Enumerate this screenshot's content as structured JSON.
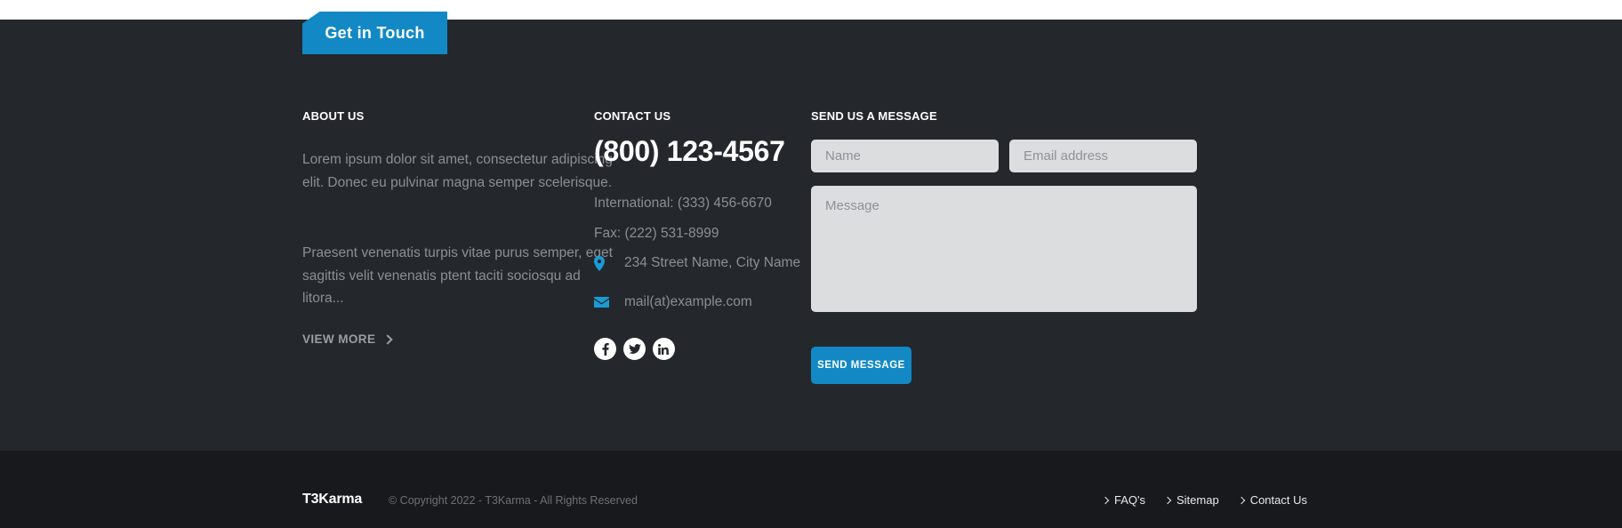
{
  "tab": {
    "label": "Get in Touch"
  },
  "about": {
    "heading": "ABOUT US",
    "paragraph1": "Lorem ipsum dolor sit amet, consectetur adipiscing elit. Donec eu pulvinar magna semper scelerisque.",
    "paragraph2": "Praesent venenatis turpis vitae purus semper, eget sagittis velit venenatis ptent taciti sociosqu ad litora...",
    "view_more_label": "VIEW MORE",
    "view_more_icon": "chevron-right-icon"
  },
  "contact": {
    "heading": "CONTACT US",
    "phone": "(800) 123-4567",
    "international": "International: (333) 456-6670",
    "fax": "Fax: (222) 531-8999",
    "address": "234 Street Name, City Name",
    "address_icon": "map-pin-icon",
    "email": "mail(at)example.com",
    "email_icon": "envelope-icon",
    "social": [
      {
        "name": "facebook-icon",
        "label": "f"
      },
      {
        "name": "twitter-icon",
        "label": "t"
      },
      {
        "name": "linkedin-icon",
        "label": "in"
      }
    ]
  },
  "form": {
    "heading": "SEND US A MESSAGE",
    "name_placeholder": "Name",
    "name_value": "",
    "email_placeholder": "Email address",
    "email_value": "",
    "message_placeholder": "Message",
    "message_value": "",
    "submit_label": "SEND MESSAGE"
  },
  "bottom": {
    "brand": "T3Karma",
    "copyright": "© Copyright 2022 - T3Karma - All Rights Reserved",
    "links": [
      {
        "label": "FAQ's"
      },
      {
        "label": "Sitemap"
      },
      {
        "label": "Contact Us"
      }
    ]
  },
  "colors": {
    "accent": "#1289c5",
    "icon_blue": "#1b9ad6",
    "dark_bg": "#24282c",
    "darker_bg": "#17191c",
    "field_bg": "#dcdddf",
    "muted_text": "#8b8f94"
  }
}
